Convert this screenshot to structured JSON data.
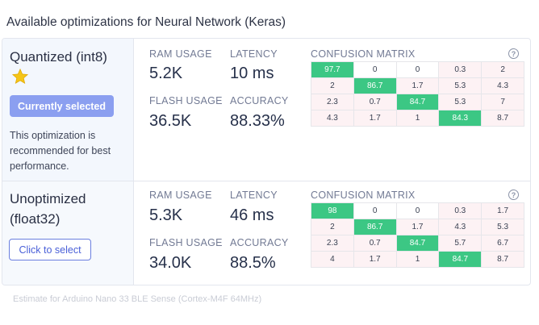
{
  "page": {
    "title": "Available optimizations for Neural Network (Keras)",
    "footer": "Estimate for Arduino Nano 33 BLE Sense (Cortex-M4F 64MHz)"
  },
  "labels": {
    "ram": "RAM USAGE",
    "latency": "LATENCY",
    "flash": "FLASH USAGE",
    "accuracy": "ACCURACY",
    "confusion": "CONFUSION MATRIX",
    "help_icon": "?"
  },
  "options": [
    {
      "name_line1": "Quantized (int8)",
      "icon": "star-icon",
      "button_label": "Currently selected",
      "note": "This optimization is recommended for best performance.",
      "ram": "5.2K",
      "latency": "10 ms",
      "flash": "36.5K",
      "accuracy": "88.33%",
      "matrix": [
        [
          "97.7",
          "0",
          "0",
          "0.3",
          "2"
        ],
        [
          "2",
          "86.7",
          "1.7",
          "5.3",
          "4.3"
        ],
        [
          "2.3",
          "0.7",
          "84.7",
          "5.3",
          "7"
        ],
        [
          "4.3",
          "1.7",
          "1",
          "84.3",
          "8.7"
        ]
      ]
    },
    {
      "name_line1": "Unoptimized",
      "name_line2": "(float32)",
      "button_label": "Click to select",
      "ram": "5.3K",
      "latency": "46 ms",
      "flash": "34.0K",
      "accuracy": "88.5%",
      "matrix": [
        [
          "98",
          "0",
          "0",
          "0.3",
          "1.7"
        ],
        [
          "2",
          "86.7",
          "1.7",
          "4.3",
          "5.3"
        ],
        [
          "2.3",
          "0.7",
          "84.7",
          "5.7",
          "6.7"
        ],
        [
          "4",
          "1.7",
          "1",
          "84.7",
          "8.7"
        ]
      ]
    }
  ],
  "colors": {
    "diagonal": "#3cc784",
    "error_cell": "#fdf2f4",
    "selected_button": "#8b9ff0",
    "select_button_border": "#6b7fe0",
    "star": "#f5c518"
  }
}
